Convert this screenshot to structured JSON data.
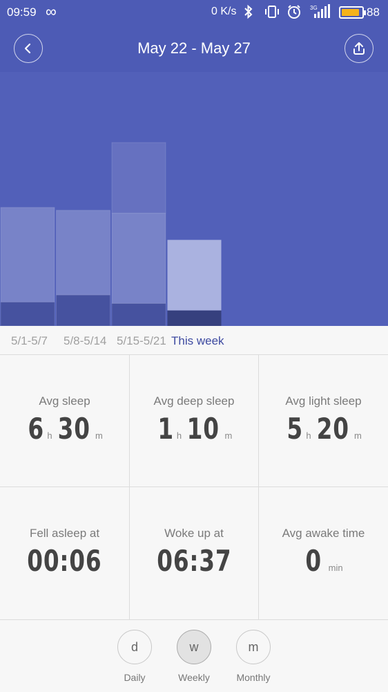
{
  "status_bar": {
    "time": "09:59",
    "net_speed": "0 K/s",
    "battery": "88",
    "battery_level": 0.88,
    "icons": [
      "infinity-icon",
      "bluetooth-icon",
      "vibrate-icon",
      "alarm-icon",
      "signal-3g-icon",
      "battery-icon"
    ]
  },
  "header": {
    "title": "May 22 - May 27"
  },
  "colors": {
    "header_bg": "#4d5bb5",
    "chart_bg": "#5260b9",
    "light_sleep_bar": "#7883c8",
    "deep_sleep_bar": "#46529f",
    "current_light_bar": "#aab2e0",
    "current_deep_bar": "#36407e",
    "active_tab": "#3d4aa0"
  },
  "chart_data": {
    "type": "bar",
    "stacked": true,
    "categories": [
      "5/1-5/7",
      "5/8-5/14",
      "5/15-5/21",
      "This week"
    ],
    "series": [
      {
        "values": [
          0.85,
          1.1,
          0.8,
          0.55
        ]
      },
      {
        "values": [
          3.35,
          3.0,
          3.2,
          2.5
        ]
      },
      {
        "values": [
          0,
          0,
          2.5,
          0
        ]
      }
    ],
    "ylim": [
      0,
      9
    ],
    "grid": false,
    "selected_category": "This week"
  },
  "week_tabs": [
    "5/1-5/7",
    "5/8-5/14",
    "5/15-5/21",
    "This week"
  ],
  "stats": {
    "avg_sleep": {
      "label": "Avg sleep",
      "hours": "6",
      "minutes": "30",
      "h_unit": "h",
      "m_unit": "m"
    },
    "avg_deep_sleep": {
      "label": "Avg deep sleep",
      "hours": "1",
      "minutes": "10",
      "h_unit": "h",
      "m_unit": "m"
    },
    "avg_light_sleep": {
      "label": "Avg light sleep",
      "hours": "5",
      "minutes": "20",
      "h_unit": "h",
      "m_unit": "m"
    },
    "fell_asleep": {
      "label": "Fell asleep at",
      "value": "00:06"
    },
    "woke_up": {
      "label": "Woke up at",
      "value": "06:37"
    },
    "awake_time": {
      "label": "Avg awake time",
      "value": "0",
      "unit": "min"
    }
  },
  "periods": [
    {
      "letter": "d",
      "label": "Daily"
    },
    {
      "letter": "w",
      "label": "Weekly"
    },
    {
      "letter": "m",
      "label": "Monthly"
    }
  ]
}
